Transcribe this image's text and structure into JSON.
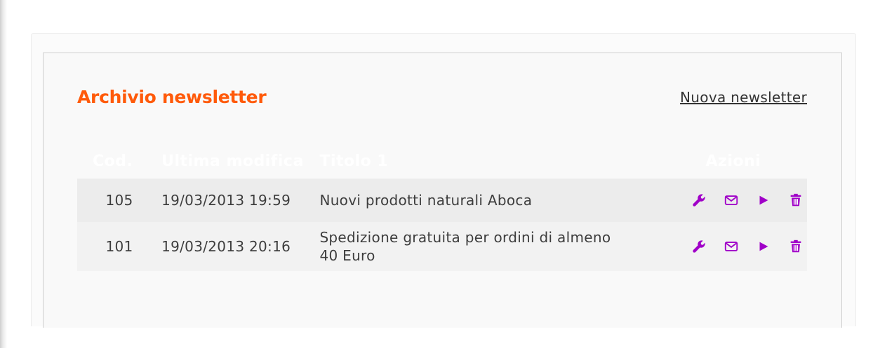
{
  "header": {
    "title": "Archivio newsletter",
    "new_link": "Nuova newsletter"
  },
  "table": {
    "columns": [
      "Cod.",
      "Ultima modifica",
      "Titolo 1",
      "Azioni"
    ],
    "rows": [
      {
        "code": "105",
        "modified": "19/03/2013 19:59",
        "title": "Nuovi prodotti naturali Aboca",
        "actions": [
          "wrench-icon",
          "envelope-icon",
          "play-icon",
          "trash-icon"
        ]
      },
      {
        "code": "101",
        "modified": "19/03/2013 20:16",
        "title": "Spedizione gratuita per ordini di almeno 40 Euro",
        "actions": [
          "wrench-icon",
          "envelope-icon",
          "play-icon",
          "trash-icon"
        ]
      }
    ]
  },
  "colors": {
    "title": "#ff5a0a",
    "icon": "#a000c8",
    "header_text": "#ffffff"
  }
}
